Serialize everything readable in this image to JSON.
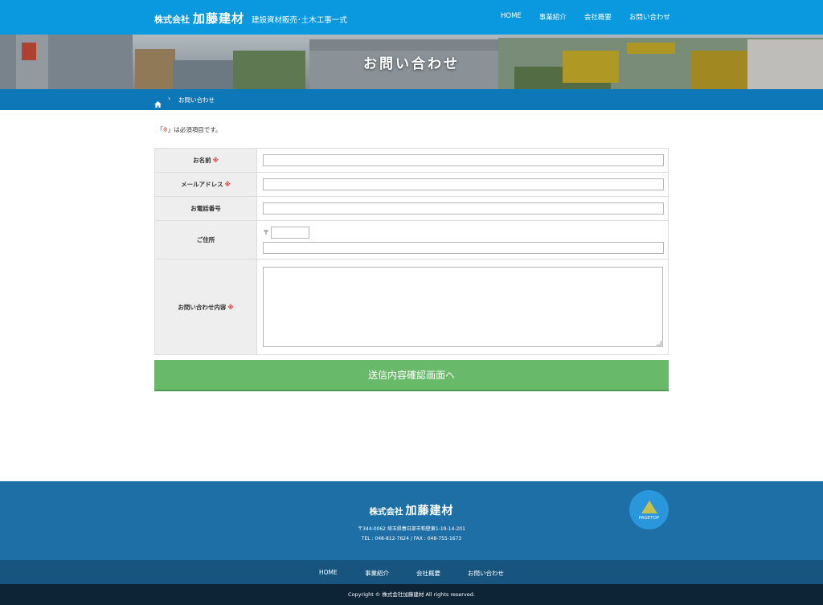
{
  "header": {
    "logo_prefix": "株式会社",
    "logo_name": "加藤建材",
    "tagline": "建設資材販売･土木工事一式",
    "nav": [
      "HOME",
      "事業紹介",
      "会社概要",
      "お問い合わせ"
    ]
  },
  "hero": {
    "title": "お問い合わせ"
  },
  "breadcrumb": {
    "current": "お問い合わせ"
  },
  "form": {
    "note_open": "「",
    "note_mark": "※",
    "note_text": "」は必須項目です。",
    "required_mark": "※",
    "postal_symbol": "〒",
    "fields": {
      "name": "お名前",
      "email": "メールアドレス",
      "phone": "お電話番号",
      "address": "ご住所",
      "message": "お問い合わせ内容"
    },
    "submit_label": "送信内容確認画面へ"
  },
  "footer": {
    "logo_prefix": "株式会社",
    "logo_name": "加藤建材",
    "address": "〒344-0062 埼玉県春日部市粕壁東1-19-14-201",
    "contact": "TEL : 048-812-7624 / FAX : 048-755-1673",
    "pagetop_label": "PAGETOP",
    "nav": [
      "HOME",
      "事業紹介",
      "会社概要",
      "お問い合わせ"
    ],
    "copyright": "Copyright © 株式会社加藤建材 All rights reserved."
  },
  "colors": {
    "header": "#0a98df",
    "breadcrumb": "#0d77b8",
    "submit": "#68b96a",
    "footer": "#1d6fa5",
    "footer_nav": "#17557f",
    "copyright_bar": "#0d2437",
    "required": "#e33333"
  }
}
